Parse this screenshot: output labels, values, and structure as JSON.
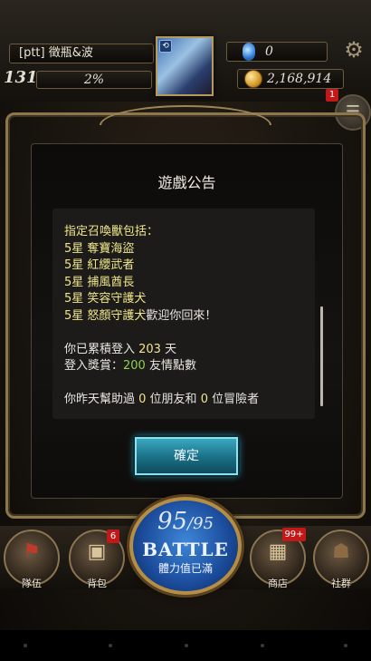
{
  "hud": {
    "player_name": "[ptt] 徵瓶&波",
    "level": "131",
    "exp_percent": "2%",
    "gems": "0",
    "gold": "2,168,914",
    "menu_badge": "1"
  },
  "dialog": {
    "title": "遊戲公告",
    "lines": {
      "l1": "指定召喚獸包括：",
      "l2": "5星 奪寶海盜",
      "l3": "5星 紅纓武者",
      "l4": "5星 捕風酋長",
      "l5": "5星 笑容守護犬",
      "l6": "5星 怒顏守護犬",
      "l6_tail": "歡迎你回來！",
      "l7_a": "你已累積登入 ",
      "l7_b": "203",
      "l7_c": " 天",
      "l8_a": "登入獎賞：",
      "l8_b": "200",
      "l8_c": " 友情點數",
      "l9_a": "你昨天幫助過 ",
      "l9_b": "0",
      "l9_c": " 位朋友和 ",
      "l9_d": "0",
      "l9_e": " 位冒險者"
    },
    "confirm_label": "確定"
  },
  "nav": {
    "team_label": "隊伍",
    "bag_label": "背包",
    "bag_badge": "6",
    "shop_label": "商店",
    "shop_badge": "99+",
    "social_label": "社群"
  },
  "battle": {
    "stamina_current": "95",
    "stamina_max": "/95",
    "label": "BATTLE",
    "status": "體力值已滿"
  },
  "colors": {
    "highlight_yellow": "#f0e68a",
    "highlight_green": "#8fd14f",
    "button_cyan": "#3aa7bf",
    "badge_red": "#c21818"
  }
}
